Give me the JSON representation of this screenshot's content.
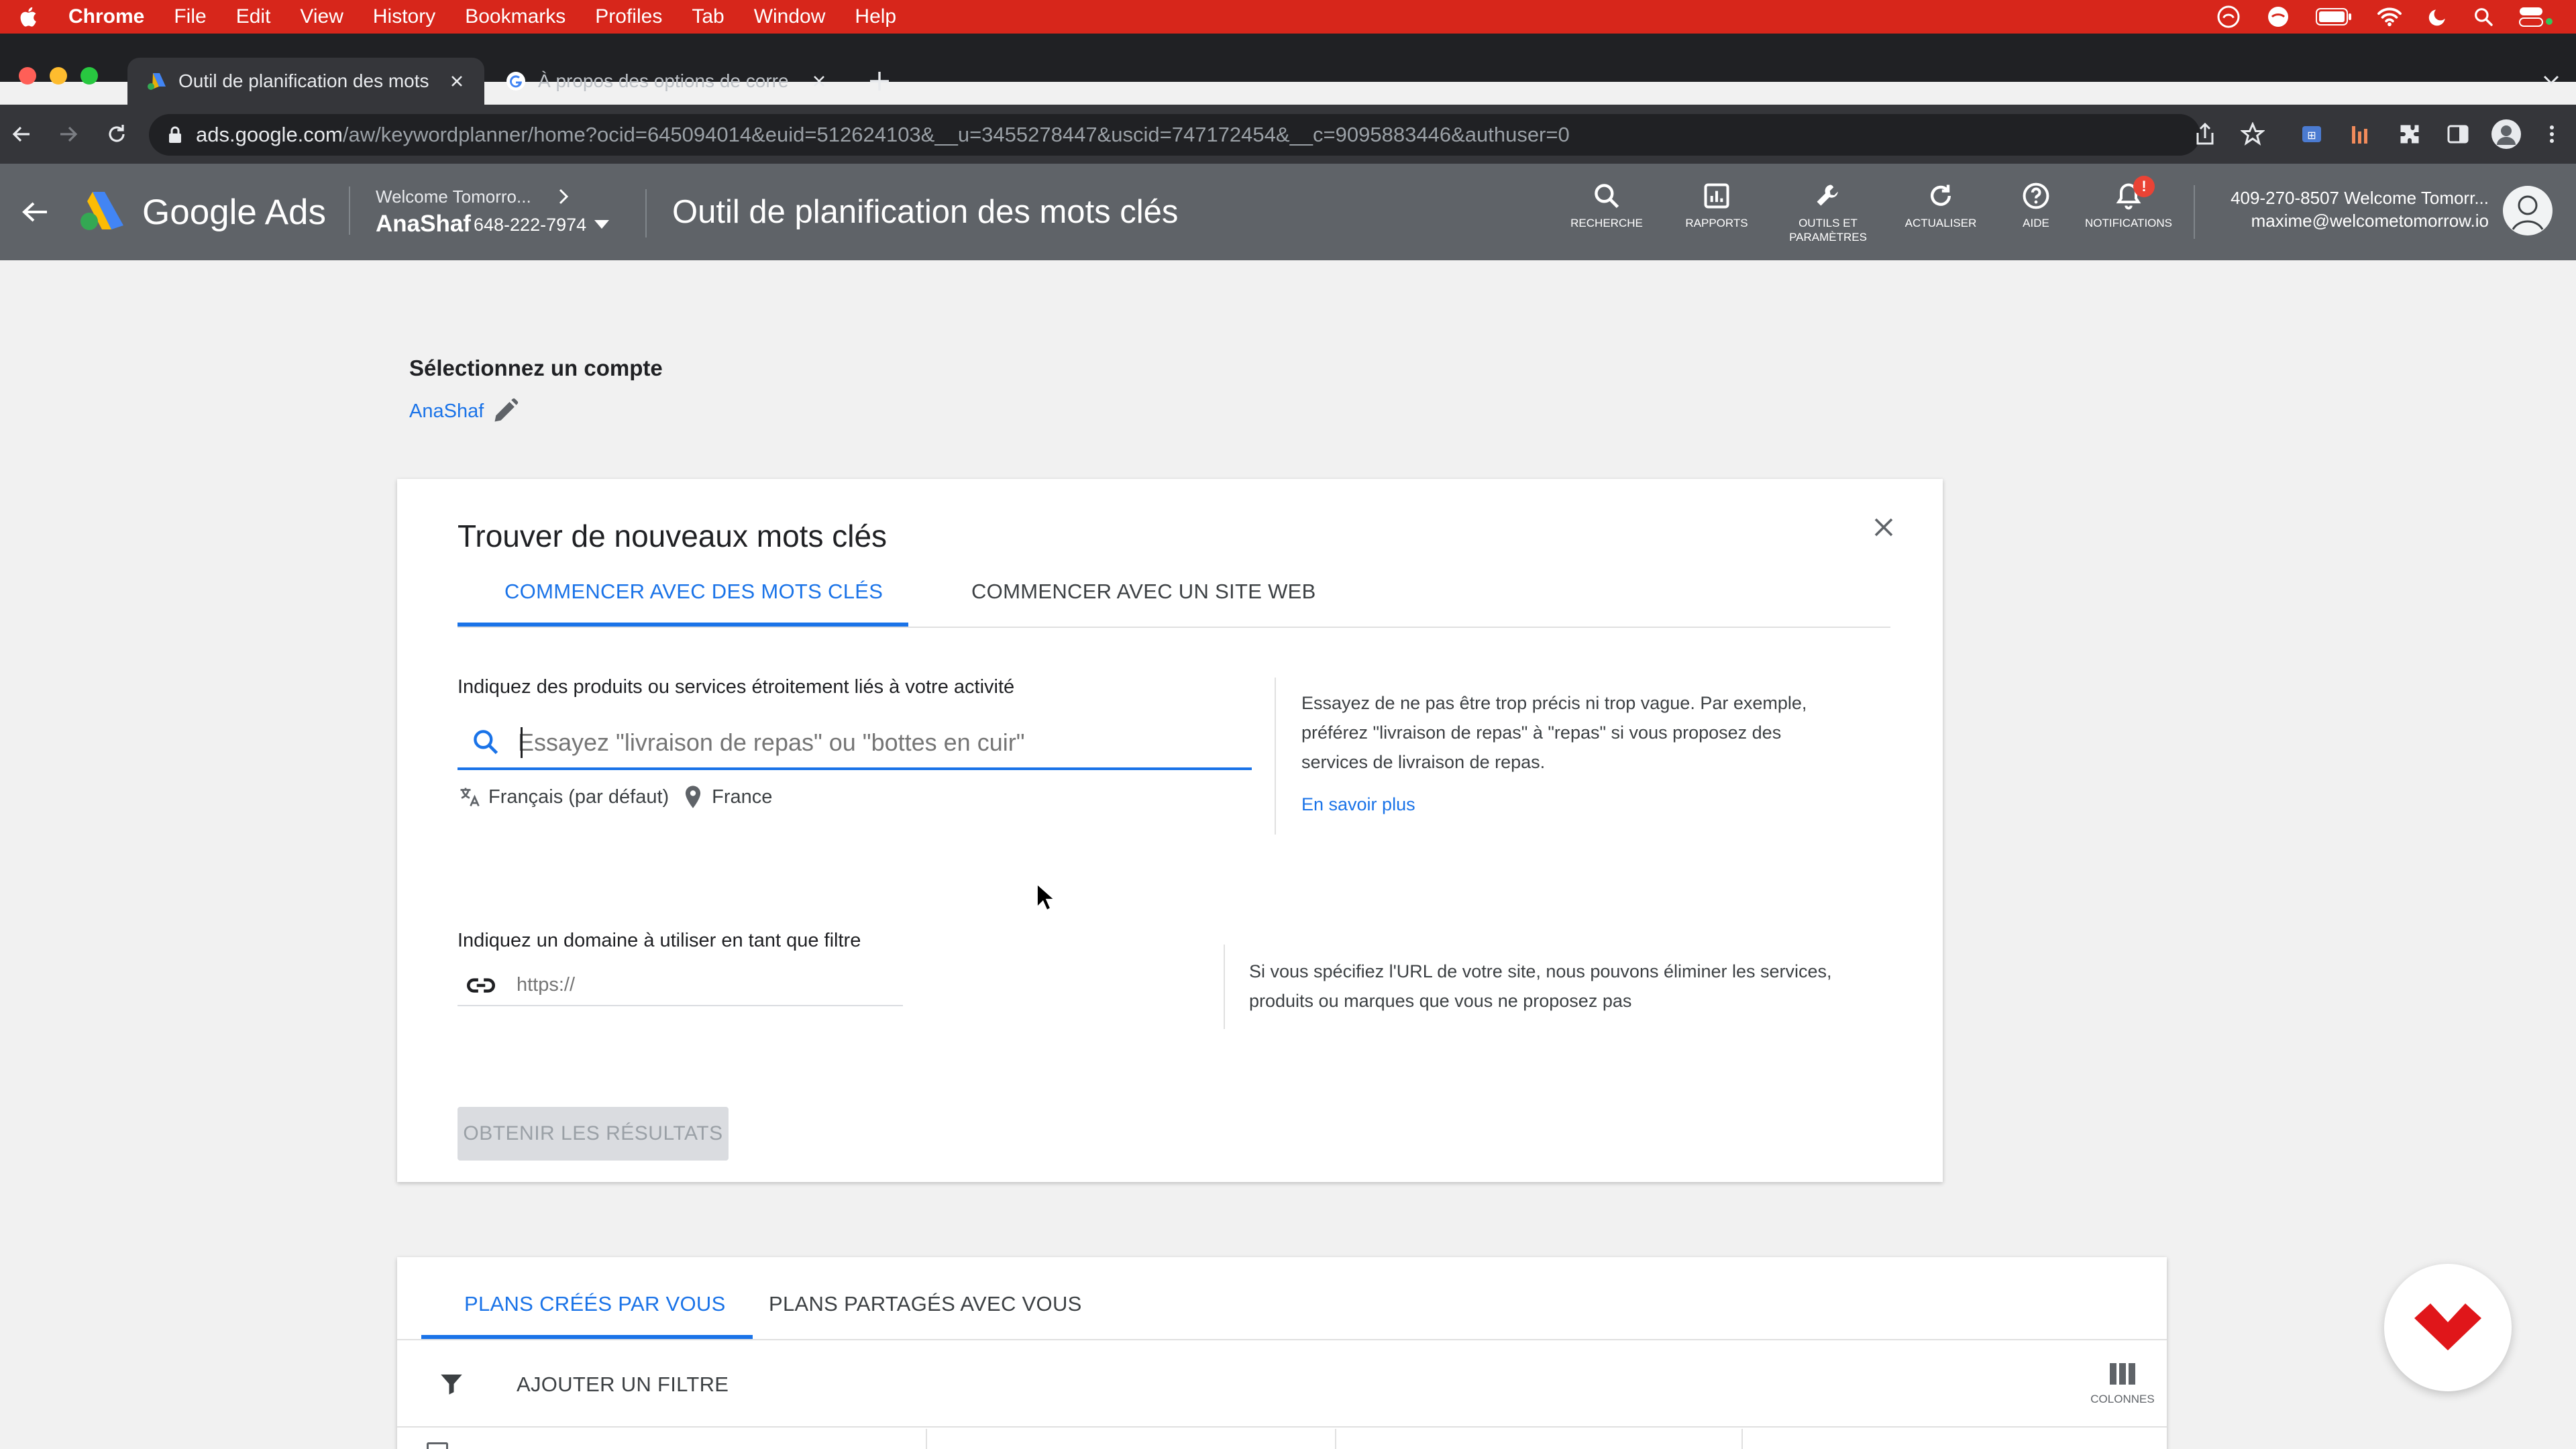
{
  "macos_menu": {
    "app": "Chrome",
    "items": [
      "File",
      "Edit",
      "View",
      "History",
      "Bookmarks",
      "Profiles",
      "Tab",
      "Window",
      "Help"
    ]
  },
  "browser": {
    "tabs": [
      {
        "title": "Outil de planification des mots",
        "active": true
      },
      {
        "title": "À propos des options de corre",
        "active": false
      }
    ],
    "url_host": "ads.google.com",
    "url_path": "/aw/keywordplanner/home?ocid=645094014&euid=512624103&__u=3455278447&uscid=747172454&__c=9095883446&authuser=0"
  },
  "ads_header": {
    "logo_text": "Google Ads",
    "account_parent": "Welcome Tomorro...",
    "account_name": "AnaShaf",
    "account_id": "648-222-7974",
    "page_title": "Outil de planification des mots clés",
    "actions": [
      {
        "label": "RECHERCHE",
        "icon": "search-icon"
      },
      {
        "label": "RAPPORTS",
        "icon": "reports-icon"
      },
      {
        "label": "OUTILS ET PARAMÈTRES",
        "icon": "wrench-icon"
      },
      {
        "label": "ACTUALISER",
        "icon": "refresh-icon"
      },
      {
        "label": "AIDE",
        "icon": "help-icon"
      },
      {
        "label": "NOTIFICATIONS",
        "icon": "bell-icon"
      }
    ],
    "notification_badge": "!",
    "user_line1": "409-270-8507 Welcome Tomorr...",
    "user_email": "maxime@welcometomorrow.io"
  },
  "account_select": {
    "heading": "Sélectionnez un compte",
    "account": "AnaShaf"
  },
  "finder": {
    "title": "Trouver de nouveaux mots clés",
    "tab_keywords": "COMMENCER AVEC DES MOTS CLÉS",
    "tab_website": "COMMENCER AVEC UN SITE WEB",
    "products_label": "Indiquez des produits ou services étroitement liés à votre activité",
    "search_placeholder": "Essayez \"livraison de repas\" ou \"bottes en cuir\"",
    "language": "Français (par défaut)",
    "location": "France",
    "help_text": "Essayez de ne pas être trop précis ni trop vague. Par exemple, préférez \"livraison de repas\" à \"repas\" si vous proposez des services de livraison de repas.",
    "help_link": "En savoir plus",
    "domain_label": "Indiquez un domaine à utiliser en tant que filtre",
    "domain_placeholder": "https://",
    "domain_help": "Si vous spécifiez l'URL de votre site, nous pouvons éliminer les services, produits ou marques que vous ne proposez pas",
    "submit": "OBTENIR LES RÉSULTATS"
  },
  "plans": {
    "tab_created": "PLANS CRÉÉS PAR VOUS",
    "tab_shared": "PLANS PARTAGÉS AVEC VOUS",
    "add_filter": "AJOUTER UN FILTRE",
    "columns": "COLONNES"
  },
  "colors": {
    "menubar": "#d7261b",
    "ads_header": "#5f6368",
    "accent_blue": "#1a73e8",
    "ads_yellow": "#fbbc04",
    "ads_green": "#34a853",
    "brand_red": "#e0161a"
  }
}
